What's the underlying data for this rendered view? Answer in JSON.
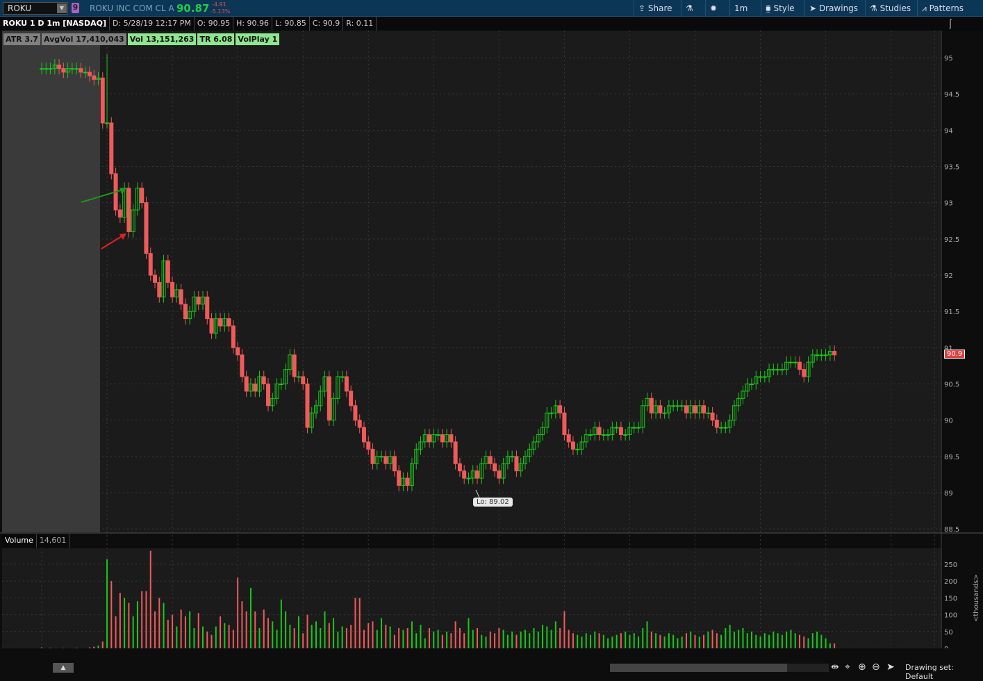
{
  "toolbar": {
    "symbol": "ROKU",
    "link_badge": "9",
    "company": "ROKU INC COM CL A",
    "last": "90.87",
    "change": "-4.91",
    "change_pct": "-5.13%",
    "share": "Share",
    "timeframe": "1m",
    "style": "Style",
    "drawings": "Drawings",
    "studies": "Studies",
    "patterns": "Patterns"
  },
  "info": {
    "title": "ROKU 1 D 1m [NASDAQ]",
    "date": "D: 5/28/19 12:17 PM",
    "open": "O: 90.95",
    "high": "H: 90.96",
    "low": "L: 90.85",
    "close": "C: 90.9",
    "range": "R: 0.11"
  },
  "studies": [
    {
      "label": "ATR 3.7",
      "tone": "g"
    },
    {
      "label": "AvgVol 17,410,043",
      "tone": "g"
    },
    {
      "label": "Vol 13,151,263",
      "tone": "lg"
    },
    {
      "label": "TR 6.08",
      "tone": "lg"
    },
    {
      "label": "VolPlay 1",
      "tone": "lg"
    }
  ],
  "volume_panel": {
    "label": "Volume",
    "value": "14,601",
    "unit": "<thousands>"
  },
  "low_label": "Lo: 89.02",
  "last_price_label": "90.9",
  "footer": {
    "drawing_set": "Drawing set: Default"
  },
  "colors": {
    "up": "#19c819",
    "down": "#f05a5a",
    "premarket": "#3a3a3a",
    "bg": "#1b1b1b"
  },
  "chart_data": {
    "type": "candlestick",
    "price_ticks": [
      "95",
      "94.5",
      "94",
      "93.5",
      "93",
      "92.5",
      "92",
      "91.5",
      "91",
      "90.5",
      "90",
      "89.5",
      "89",
      "88.5"
    ],
    "price_range": [
      88.5,
      95.2
    ],
    "volume_ticks": [
      "250",
      "200",
      "150",
      "100",
      "50",
      "0"
    ],
    "volume_range": [
      0,
      260
    ],
    "time_ticks": [
      "9:15",
      "9:30",
      "9:45",
      "10:00",
      "10:15",
      "10:30",
      "10:45",
      "11:00",
      "11:15",
      "11:30",
      "11:45",
      "12:00",
      "12:15",
      "12:30",
      "12:40"
    ],
    "start_time": "9:15",
    "premarket_minutes": 15,
    "first_open": 94.85,
    "closes": [
      94.85,
      94.85,
      94.85,
      94.9,
      94.85,
      94.8,
      94.85,
      94.85,
      94.85,
      94.8,
      94.8,
      94.75,
      94.7,
      94.72,
      94.1,
      94.1,
      93.4,
      92.9,
      92.8,
      93.2,
      92.6,
      92.9,
      93.2,
      93.0,
      92.3,
      92.0,
      91.9,
      91.7,
      92.2,
      91.9,
      91.7,
      91.8,
      91.6,
      91.4,
      91.5,
      91.7,
      91.6,
      91.7,
      91.4,
      91.2,
      91.4,
      91.3,
      91.4,
      91.3,
      91.0,
      90.9,
      90.6,
      90.4,
      90.5,
      90.4,
      90.6,
      90.5,
      90.2,
      90.3,
      90.5,
      90.5,
      90.7,
      90.9,
      90.6,
      90.6,
      90.5,
      89.9,
      90.1,
      90.2,
      90.4,
      90.6,
      90.0,
      90.3,
      90.6,
      90.6,
      90.4,
      90.2,
      90.0,
      89.9,
      89.7,
      89.6,
      89.4,
      89.5,
      89.5,
      89.4,
      89.5,
      89.3,
      89.1,
      89.2,
      89.1,
      89.4,
      89.6,
      89.7,
      89.8,
      89.7,
      89.8,
      89.8,
      89.7,
      89.8,
      89.7,
      89.4,
      89.3,
      89.2,
      89.2,
      89.3,
      89.2,
      89.4,
      89.5,
      89.4,
      89.3,
      89.2,
      89.4,
      89.5,
      89.5,
      89.3,
      89.4,
      89.5,
      89.6,
      89.7,
      89.8,
      89.9,
      90.1,
      90.1,
      90.2,
      90.1,
      89.8,
      89.7,
      89.6,
      89.6,
      89.7,
      89.8,
      89.8,
      89.9,
      89.8,
      89.8,
      89.8,
      89.9,
      89.9,
      89.8,
      89.8,
      89.9,
      89.9,
      89.9,
      90.2,
      90.3,
      90.1,
      90.2,
      90.1,
      90.1,
      90.2,
      90.2,
      90.2,
      90.2,
      90.1,
      90.2,
      90.1,
      90.2,
      90.1,
      90.1,
      90.0,
      89.9,
      89.9,
      89.9,
      90.0,
      90.2,
      90.3,
      90.4,
      90.5,
      90.5,
      90.6,
      90.6,
      90.6,
      90.7,
      90.7,
      90.7,
      90.7,
      90.8,
      90.8,
      90.8,
      90.7,
      90.6,
      90.8,
      90.9,
      90.9,
      90.9,
      90.9,
      90.95,
      90.9
    ],
    "spike": {
      "index": 15,
      "high": 95.05
    },
    "low": {
      "value": 89.02,
      "index": 83
    },
    "volumes": [
      3,
      0,
      2,
      0,
      0,
      1,
      0,
      0,
      2,
      0,
      0,
      3,
      5,
      8,
      20,
      265,
      200,
      95,
      165,
      150,
      135,
      95,
      140,
      170,
      170,
      290,
      110,
      150,
      135,
      85,
      100,
      65,
      115,
      95,
      110,
      60,
      105,
      65,
      50,
      40,
      65,
      95,
      75,
      70,
      55,
      210,
      140,
      110,
      180,
      110,
      60,
      115,
      90,
      80,
      55,
      145,
      110,
      70,
      60,
      95,
      45,
      100,
      70,
      80,
      60,
      110,
      75,
      90,
      50,
      65,
      60,
      70,
      150,
      150,
      55,
      75,
      80,
      55,
      90,
      70,
      65,
      40,
      60,
      55,
      60,
      80,
      45,
      70,
      30,
      60,
      50,
      55,
      40,
      50,
      45,
      80,
      60,
      45,
      90,
      55,
      60,
      40,
      35,
      50,
      45,
      60,
      55,
      40,
      50,
      40,
      50,
      55,
      45,
      60,
      50,
      70,
      65,
      55,
      80,
      60,
      110,
      55,
      45,
      40,
      35,
      45,
      40,
      50,
      45,
      40,
      30,
      35,
      40,
      45,
      50,
      40,
      45,
      35,
      60,
      80,
      50,
      45,
      40,
      35,
      45,
      40,
      30,
      35,
      45,
      50,
      40,
      35,
      40,
      50,
      55,
      45,
      40,
      60,
      70,
      50,
      55,
      60,
      45,
      50,
      40,
      35,
      45,
      40,
      50,
      45,
      40,
      50,
      55,
      45,
      40,
      35,
      30,
      45,
      50,
      40,
      30,
      15,
      14.6
    ]
  }
}
